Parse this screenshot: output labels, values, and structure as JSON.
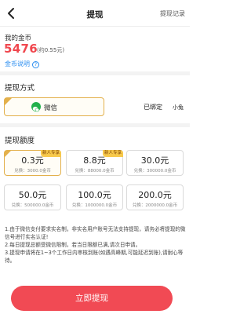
{
  "header": {
    "title": "提现",
    "records_label": "提现记录",
    "back_icon": "chevron-left-icon"
  },
  "gold": {
    "label": "我的金币",
    "amount": "5476",
    "rmb": "(约0.55元)",
    "help_label": "金币说明",
    "help_icon_glyph": "?"
  },
  "method": {
    "section_title": "提现方式",
    "selected_label": "微信",
    "bound_label": "已绑定",
    "bound_name": "小兔"
  },
  "amounts": {
    "section_title": "提现额度",
    "options": [
      {
        "value": "0.3元",
        "cost": "兑换：3000.0金币",
        "badge": "新人专享",
        "selected": true
      },
      {
        "value": "8.8元",
        "cost": "兑换：88000.0金币",
        "badge": "新人专享",
        "selected": false
      },
      {
        "value": "30.0元",
        "cost": "兑换：300000.0金币",
        "badge": "",
        "selected": false
      },
      {
        "value": "50.0元",
        "cost": "兑换：500000.0金币",
        "badge": "",
        "selected": false
      },
      {
        "value": "100.0元",
        "cost": "兑换：1000000.0金币",
        "badge": "",
        "selected": false
      },
      {
        "value": "200.0元",
        "cost": "兑换：2000000.0金币",
        "badge": "",
        "selected": false
      }
    ]
  },
  "notes": [
    "1.由于微信支付要求实名制，非实名用户账号无法支持提现，请务必将提现的微信号进行实名认证!",
    "2.每日提现总额受微信限制，若当日限额已满,请次日申请。",
    "3.提现申请将在1~3个工作日内审核到账(如遇高峰期,可能延迟到账),请耐心等待。"
  ],
  "submit_label": "立即提现",
  "colors": {
    "accent": "#f14a54",
    "gold_amount": "#f0474e",
    "selected_border": "#e3b04b",
    "help_link": "#2a8df0",
    "wechat": "#22b14c"
  }
}
